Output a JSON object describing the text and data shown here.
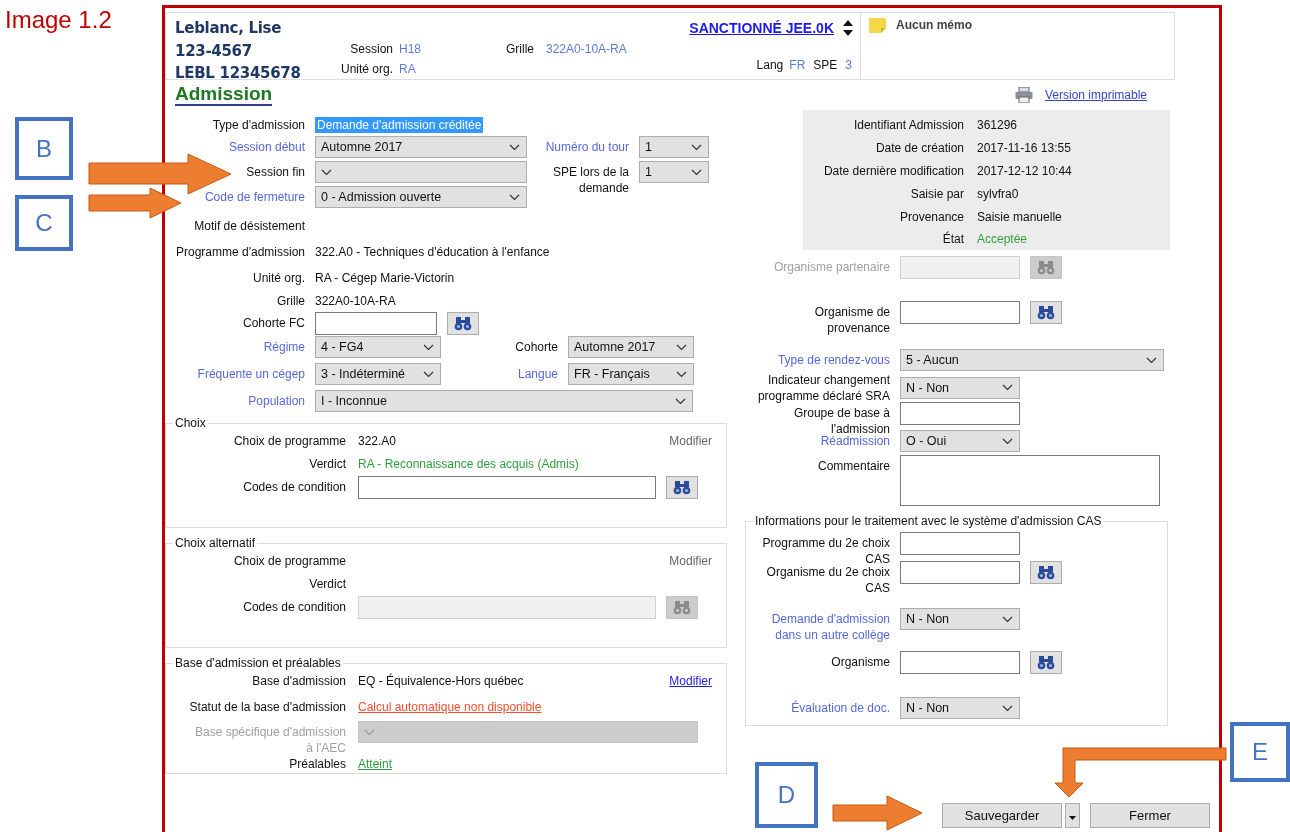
{
  "annotation": {
    "title": "Image 1.2",
    "markers": [
      {
        "label": "B"
      },
      {
        "label": "C"
      },
      {
        "label": "D"
      },
      {
        "label": "E"
      }
    ]
  },
  "header": {
    "student": [
      "Leblanc, Lise",
      "123-4567",
      "LEBL 12345678"
    ],
    "fields": [
      {
        "label": "Session",
        "value": "H18"
      },
      {
        "label": "Unité org.",
        "value": "RA"
      },
      {
        "label": "Grille",
        "value": "322A0-10A-RA"
      },
      {
        "label": "Lang",
        "value": "FR"
      },
      {
        "label": "SPE",
        "value": "3"
      }
    ],
    "status_link": "SANCTIONNÉ JEE.0K",
    "memo": "Aucun mémo"
  },
  "title": "Admission",
  "print_link": "Version imprimable",
  "left_rows": [
    {
      "fields": [
        {
          "label": "Type d'admission",
          "linked": false,
          "kind": "highlight",
          "value": "Demande d'admission créditée"
        }
      ]
    },
    {
      "fields": [
        {
          "label": "Session début",
          "linked": true,
          "disabled": false,
          "kind": "select",
          "value": "Automne 2017"
        },
        {
          "label": "Numéro du tour",
          "linked": true,
          "disabled": false,
          "kind": "select",
          "value": "1"
        }
      ]
    },
    {
      "fields": [
        {
          "label": "Session fin",
          "linked": false,
          "disabled": false,
          "kind": "select"
        },
        {
          "label": "SPE lors de la demande",
          "linked": false,
          "disabled": false,
          "kind": "select",
          "value": "1"
        }
      ]
    },
    {
      "fields": [
        {
          "label": "Code de fermeture",
          "linked": true,
          "disabled": false,
          "kind": "select",
          "value": "0 - Admission ouverte"
        }
      ]
    },
    {
      "fields": [
        {
          "label": "Motif de désistement",
          "linked": false,
          "kind": "none"
        }
      ]
    },
    {
      "fields": [
        {
          "label": "Programme d'admission",
          "linked": false,
          "kind": "text",
          "value": "322.A0 - Techniques d'éducation à l'enfance"
        }
      ]
    },
    {
      "fields": [
        {
          "label": "Unité org.",
          "linked": false,
          "kind": "text",
          "value": "RA - Cégep Marie-Victorin"
        }
      ]
    },
    {
      "fields": [
        {
          "label": "Grille",
          "linked": false,
          "kind": "text",
          "value": "322A0-10A-RA"
        }
      ]
    },
    {
      "fields": [
        {
          "label": "Cohorte FC",
          "linked": false,
          "disabled": false,
          "kind": "lookup"
        }
      ]
    },
    {
      "fields": [
        {
          "label": "Régime",
          "linked": true,
          "disabled": false,
          "kind": "select",
          "value": "4 - FG4"
        },
        {
          "label": "Cohorte",
          "linked": false,
          "disabled": false,
          "kind": "select",
          "value": "Automne 2017"
        }
      ]
    },
    {
      "fields": [
        {
          "label": "Fréquente un cégep",
          "linked": true,
          "disabled": false,
          "kind": "select",
          "value": "3 - Indéterminé"
        },
        {
          "label": "Langue",
          "linked": true,
          "disabled": false,
          "kind": "select",
          "value": "FR - Français"
        }
      ]
    },
    {
      "fields": [
        {
          "label": "Population",
          "linked": true,
          "disabled": false,
          "kind": "select",
          "value": "I - Inconnue"
        }
      ]
    }
  ],
  "groups": [
    {
      "title": "Choix",
      "modify": {
        "label": "Modifier",
        "disabled": true
      },
      "rows": [
        {
          "label": "Choix de programme",
          "linked": false,
          "kind": "text",
          "value": "322.A0",
          "color": "#111111",
          "link": false
        },
        {
          "label": "Verdict",
          "linked": false,
          "kind": "text",
          "value": "RA - Reconnaissance des acquis (Admis)",
          "color": "#2e9e3a",
          "link": false
        },
        {
          "label": "Codes de condition",
          "linked": false,
          "disabled": false,
          "kind": "lookup"
        }
      ]
    },
    {
      "title": "Choix alternatif",
      "modify": {
        "label": "Modifier",
        "disabled": true
      },
      "rows": [
        {
          "label": "Choix de programme",
          "linked": false,
          "kind": "none"
        },
        {
          "label": "Verdict",
          "linked": false,
          "kind": "none"
        },
        {
          "label": "Codes de condition",
          "linked": false,
          "disabled": true,
          "kind": "lookup"
        }
      ]
    },
    {
      "title": "Base d'admission et préalables",
      "modify": {
        "label": "Modifier",
        "disabled": false
      },
      "rows": [
        {
          "label": "Base d'admission",
          "linked": false,
          "kind": "text",
          "value": "EQ - Équivalence-Hors québec",
          "color": "#111111",
          "link": false
        },
        {
          "label": "Statut de la base d'admission",
          "linked": false,
          "kind": "text",
          "value": "Calcul automatique non disponible",
          "color": "#ff4b2b",
          "link": true
        },
        {
          "label": "Base spécifique d'admission à l'AEC",
          "linked": false,
          "label_disabled": true,
          "disabled": true,
          "kind": "select"
        },
        {
          "label": "Préalables",
          "linked": false,
          "kind": "text",
          "value": "Atteint",
          "color": "#2e9e3a",
          "link": true
        }
      ]
    }
  ],
  "info": [
    {
      "label": "Identifiant Admission",
      "value": "361296",
      "color": "#111111"
    },
    {
      "label": "Date de création",
      "value": "2017-11-16 13:55",
      "color": "#111111"
    },
    {
      "label": "Date dernière modification",
      "value": "2017-12-12 10:44",
      "color": "#111111"
    },
    {
      "label": "Saisie par",
      "value": "sylvfra0",
      "color": "#111111"
    },
    {
      "label": "Provenance",
      "value": "Saisie manuelle",
      "color": "#111111"
    },
    {
      "label": "État",
      "value": "Acceptée",
      "color": "#2e9e3a"
    }
  ],
  "right_rows": [
    {
      "label": "Organisme partenaire",
      "linked": false,
      "label_disabled": true,
      "disabled": true,
      "kind": "lookup"
    },
    {
      "label": "Organisme de provenance",
      "linked": false,
      "disabled": false,
      "kind": "lookup"
    },
    {
      "label": "Type de rendez-vous",
      "linked": true,
      "disabled": false,
      "kind": "select",
      "value": "5 - Aucun"
    },
    {
      "label": "Indicateur changement programme déclaré SRA",
      "linked": false,
      "disabled": false,
      "kind": "select",
      "value": "N - Non"
    },
    {
      "label": "Groupe de base à l'admission",
      "linked": false,
      "disabled": false,
      "kind": "input"
    },
    {
      "label": "Réadmission",
      "linked": true,
      "disabled": false,
      "kind": "select",
      "value": "O - Oui"
    },
    {
      "label": "Commentaire",
      "linked": false,
      "disabled": false,
      "kind": "textarea"
    }
  ],
  "cas": {
    "title": "Informations pour le traitement avec le système d'admission CAS",
    "rows": [
      {
        "label": "Programme du 2e choix CAS",
        "linked": false,
        "disabled": false,
        "kind": "input"
      },
      {
        "label": "Organisme du 2e choix CAS",
        "linked": false,
        "disabled": false,
        "kind": "lookup"
      },
      {
        "label": "Demande d'admission dans un autre collège",
        "linked": true,
        "disabled": false,
        "kind": "select",
        "value": "N - Non"
      },
      {
        "label": "Organisme",
        "linked": false,
        "disabled": false,
        "kind": "lookup"
      },
      {
        "label": "Évaluation de doc.",
        "linked": true,
        "disabled": false,
        "kind": "select",
        "value": "N - Non"
      }
    ]
  },
  "buttons": [
    {
      "label": "Sauvegarder",
      "kind": "split"
    },
    {
      "label": "Fermer",
      "kind": "plain"
    }
  ]
}
